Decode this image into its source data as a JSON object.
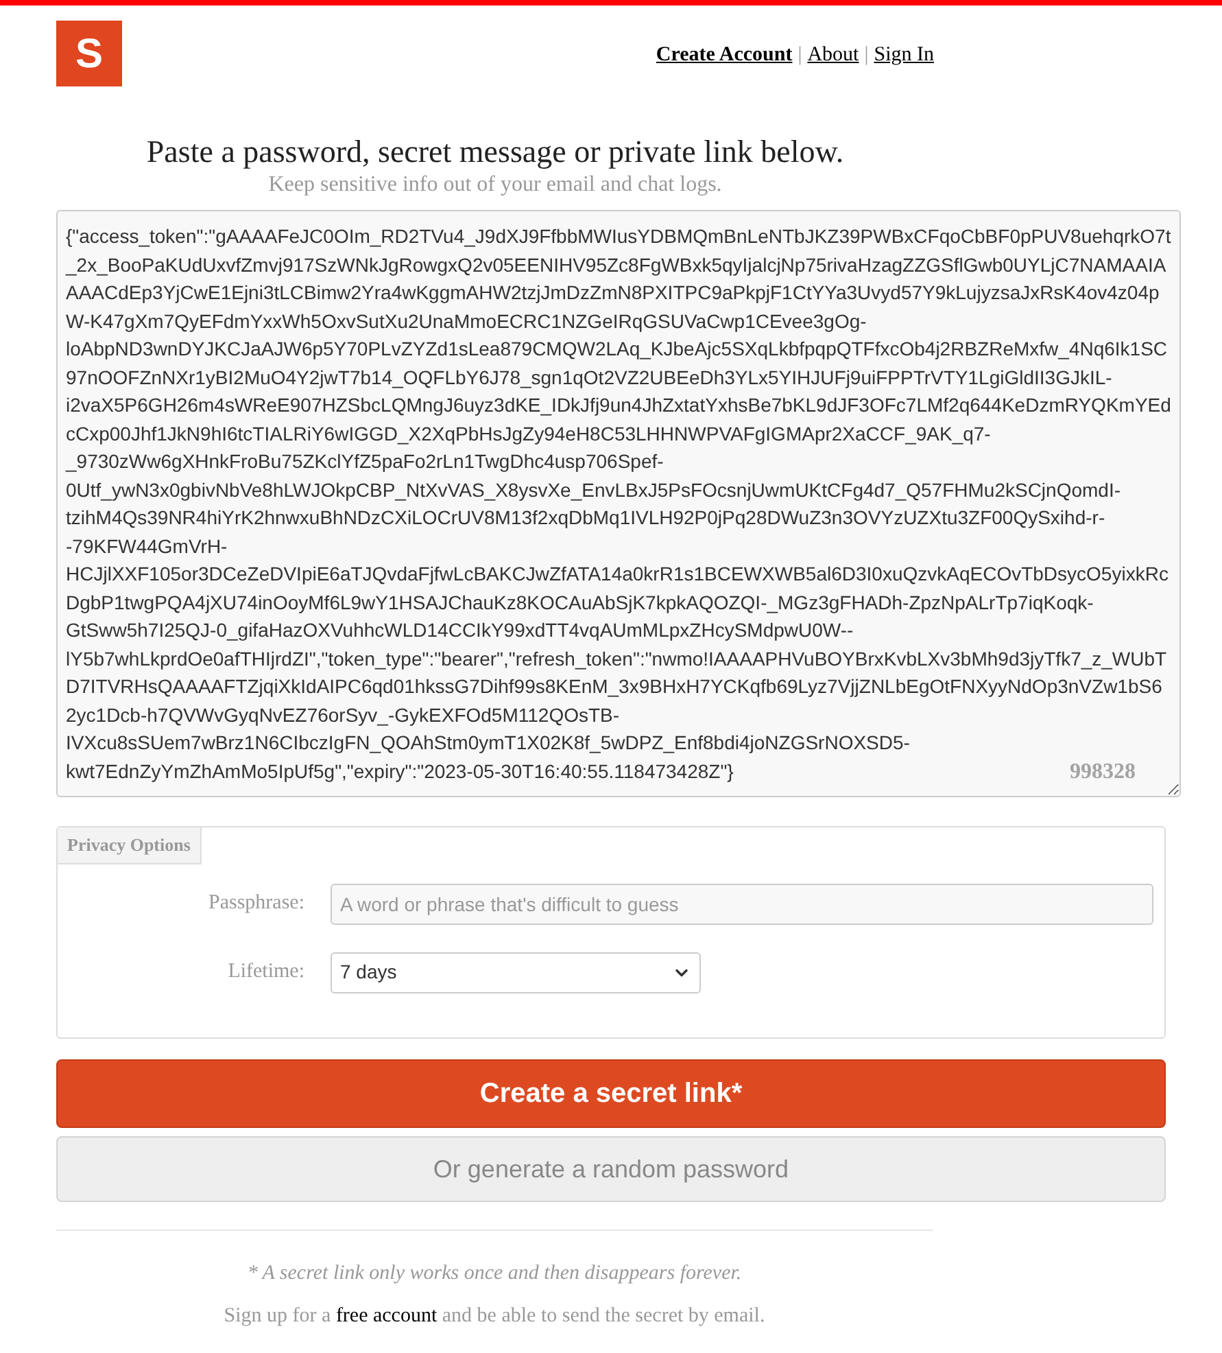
{
  "header": {
    "logo": "S",
    "nav": [
      {
        "kind": "strong",
        "label": "Create Account"
      },
      {
        "kind": "separator",
        "label": "|"
      },
      {
        "kind": "link",
        "label": "About"
      },
      {
        "kind": "separator",
        "label": "|"
      },
      {
        "kind": "link",
        "label": "Sign In"
      }
    ]
  },
  "intro": {
    "title": "Paste a password, secret message or private link below.",
    "subtitle": "Keep sensitive info out of your email and chat logs."
  },
  "secret": {
    "value": "{\"access_token\":\"gAAAAFeJC0OIm_RD2TVu4_J9dXJ9FfbbMWIusYDBMQmBnLeNTbJKZ39PWBxCFqoCbBF0pPUV8uehqrkO7t_2x_BooPaKUdUxvfZmvj917SzWNkJgRowgxQ2v05EENIHV95Zc8FgWBxk5qyIjalcjNp75rivaHzagZZGSflGwb0UYLjC7NAMAAIAAAACdEp3YjCwE1Ejni3tLCBimw2Yra4wKggmAHW2tzjJmDzZmN8PXITPC9aPkpjF1CtYYa3Uvyd57Y9kLujyzsaJxRsK4ov4z04pW-K47gXm7QyEFdmYxxWh5OxvSutXu2UnaMmoECRC1NZGeIRqGSUVaCwp1CEvee3gOg-loAbpND3wnDYJKCJaAJW6p5Y70PLvZYZd1sLea879CMQW2LAq_KJbeAjc5SXqLkbfpqpQTFfxcOb4j2RBZReMxfw_4Nq6Ik1SC97nOOFZnNXr1yBI2MuO4Y2jwT7b14_OQFLbY6J78_sgn1qOt2VZ2UBEeDh3YLx5YIHJUFj9uiFPPTrVTY1LgiGldII3GJkIL-i2vaX5P6GH26m4sWReE907HZSbcLQMngJ6uyz3dKE_IDkJfj9un4JhZxtatYxhsBe7bKL9dJF3OFc7LMf2q644KeDzmRYQKmYEdcCxp00Jhf1JkN9hI6tcTIALRiY6wIGGD_X2XqPbHsJgZy94eH8C53LHHNWPVAFgIGMApr2XaCCF_9AK_q7-_9730zWw6gXHnkFroBu75ZKclYfZ5paFo2rLn1TwgDhc4usp706Spef-0Utf_ywN3x0gbivNbVe8hLWJOkpCBP_NtXvVAS_X8ysvXe_EnvLBxJ5PsFOcsnjUwmUKtCFg4d7_Q57FHMu2kSCjnQomdI-tzihM4Qs39NR4hiYrK2hnwxuBhNDzCXiLOCrUV8M13f2xqDbMq1IVLH92P0jPq28DWuZ3n3OVYzUZXtu3ZF00QySxihd-r--79KFW44GmVrH-HCJjlXXF105or3DCeZeDVIpiE6aTJQvdaFjfwLcBAKCJwZfATA14a0krR1s1BCEWXWB5al6D3I0xuQzvkAqECOvTbDsycO5yixkRcDgbP1twgPQA4jXU74inOoyMf6L9wY1HSAJChauKz8KOCAuAbSjK7kpkAQOZQI-_MGz3gFHADh-ZpzNpALrTp7iqKoqk-GtSww5h7I25QJ-0_gifaHazOXVuhhcWLD14CCIkY99xdTT4vqAUmMLpxZHcySMdpwU0W--lY5b7whLkprdOe0afTHIjrdZI\",\"token_type\":\"bearer\",\"refresh_token\":\"nwmo!IAAAAPHVuBOYBrxKvbLXv3bMh9d3jyTfk7_z_WUbTD7ITVRHsQAAAAFTZjqiXkIdAIPC6qd01hkssG7Dihf99s8KEnM_3x9BHxH7YCKqfb69Lyz7VjjZNLbEgOtFNXyyNdOp3nVZw1bS62yc1Dcb-h7QVWvGyqNvEZ76orSyv_-GykEXFOd5M112QOsTB-IVXcu8sSUem7wBrz1N6CIbczIgFN_QOAhStm0ymT1X02K8f_5wDPZ_Enf8bdi4joNZGSrNOXSD5-kwt7EdnZyYmZhAmMo5IpUf5g\",\"expiry\":\"2023-05-30T16:40:55.118473428Z\"}",
    "counter": "998328"
  },
  "privacy": {
    "legend": "Privacy Options",
    "passphrase": {
      "label": "Passphrase:",
      "placeholder": "A word or phrase that's difficult to guess"
    },
    "lifetime": {
      "label": "Lifetime:",
      "value": "7 days"
    }
  },
  "buttons": [
    {
      "kind": "primary",
      "label": "Create a secret link*"
    },
    {
      "kind": "secondary",
      "label": "Or generate a random password"
    }
  ],
  "footer": {
    "note": "* A secret link only works once and then disappears forever.",
    "signup": {
      "before": "Sign up for a",
      "link": "free account",
      "after": "and be able to send the secret by email."
    }
  }
}
